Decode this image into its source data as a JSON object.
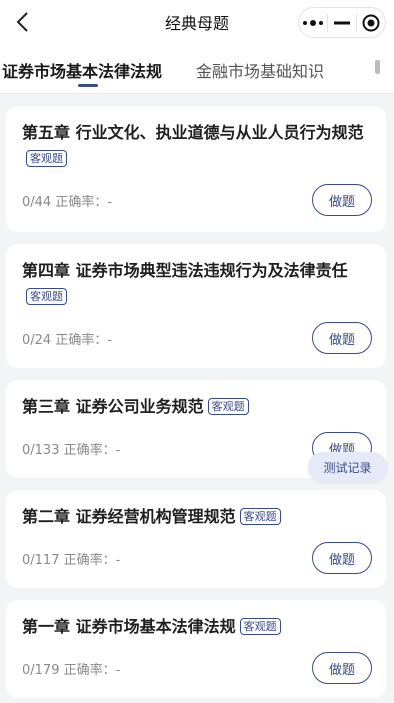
{
  "header": {
    "title": "经典母题"
  },
  "tabs": [
    {
      "label": "证券市场基本法律法规",
      "active": true
    },
    {
      "label": "金融市场基础知识",
      "active": false
    }
  ],
  "chapters": [
    {
      "title": "第五章 行业文化、执业道德与从业人员行为规范",
      "tag": "客观题",
      "progress": "0/44",
      "accuracy": "正确率：-",
      "button": "做题"
    },
    {
      "title": "第四章 证券市场典型违法违规行为及法律责任",
      "tag": "客观题",
      "progress": "0/24",
      "accuracy": "正确率：-",
      "button": "做题"
    },
    {
      "title": "第三章 证券公司业务规范",
      "tag": "客观题",
      "progress": "0/133",
      "accuracy": "正确率：-",
      "button": "做题"
    },
    {
      "title": "第二章 证券经营机构管理规范",
      "tag": "客观题",
      "progress": "0/117",
      "accuracy": "正确率：-",
      "button": "做题"
    },
    {
      "title": "第一章 证券市场基本法律法规",
      "tag": "客观题",
      "progress": "0/179",
      "accuracy": "正确率：-",
      "button": "做题"
    }
  ],
  "floating": {
    "record_label": "测试记录"
  },
  "colors": {
    "accent": "#3a4a86",
    "background": "#f3f4f6"
  }
}
